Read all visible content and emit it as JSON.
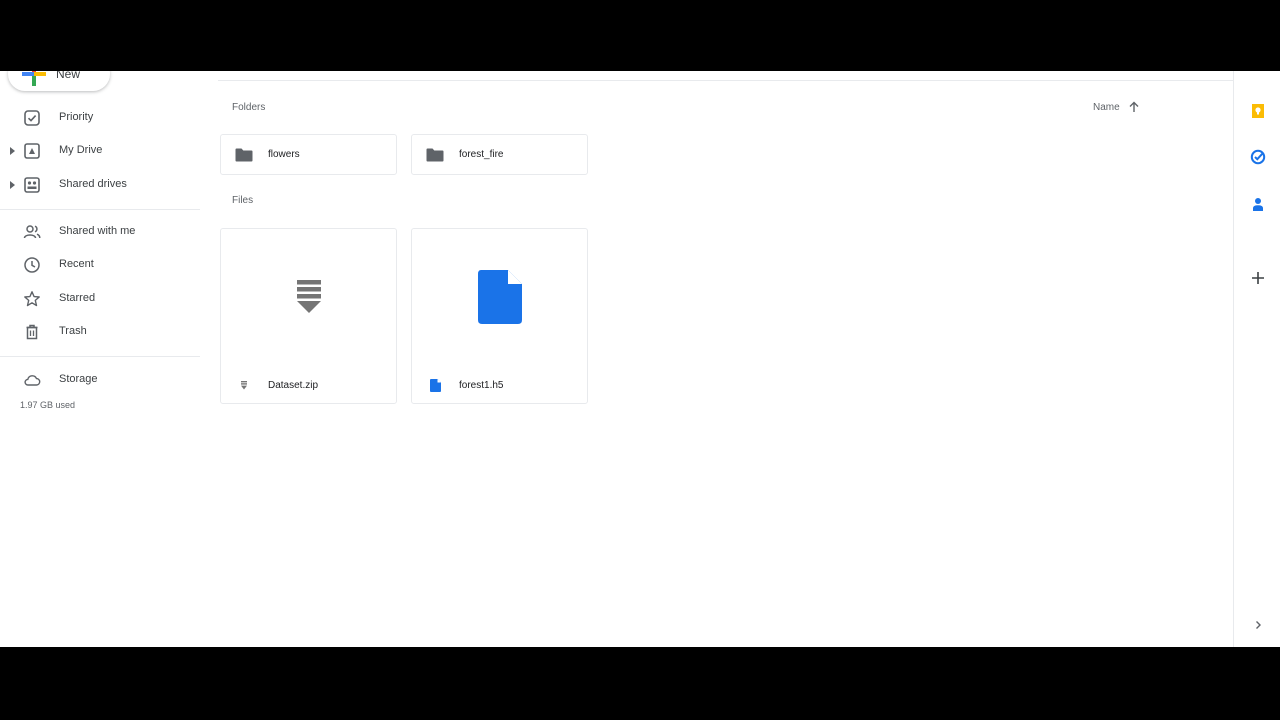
{
  "sidebar": {
    "new_label": "New",
    "items": [
      {
        "label": "Priority",
        "icon": "priority-icon"
      },
      {
        "label": "My Drive",
        "icon": "my-drive-icon"
      },
      {
        "label": "Shared drives",
        "icon": "shared-drives-icon"
      },
      {
        "label": "Shared with me",
        "icon": "shared-with-me-icon"
      },
      {
        "label": "Recent",
        "icon": "clock-icon"
      },
      {
        "label": "Starred",
        "icon": "star-icon"
      },
      {
        "label": "Trash",
        "icon": "trash-icon"
      },
      {
        "label": "Storage",
        "icon": "cloud-icon"
      }
    ],
    "storage_used": "1.97 GB used"
  },
  "main": {
    "folders_label": "Folders",
    "files_label": "Files",
    "sort_label": "Name",
    "folders": [
      {
        "name": "flowers"
      },
      {
        "name": "forest_fire"
      }
    ],
    "files": [
      {
        "name": "Dataset.zip",
        "icon": "zip-icon"
      },
      {
        "name": "forest1.h5",
        "icon": "file-icon"
      }
    ]
  },
  "right_panel": {
    "items": [
      "keep-icon",
      "tasks-icon",
      "contacts-icon",
      "add-icon",
      "chevron-right-icon"
    ]
  },
  "colors": {
    "accent_blue": "#1a73e8",
    "keep_yellow": "#fbbc04",
    "text_dark": "#202124",
    "text_grey": "#5f6368"
  }
}
